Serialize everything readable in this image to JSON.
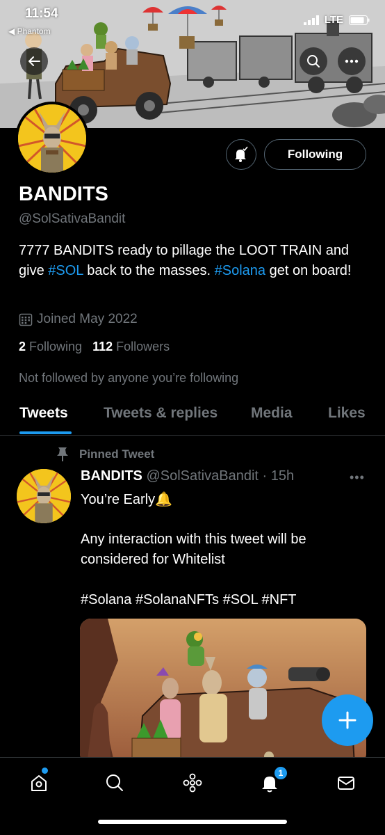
{
  "status_bar": {
    "time": "11:54",
    "back_app": "◀ Phantom",
    "network": "LTE"
  },
  "profile": {
    "name": "BANDITS",
    "handle": "@SolSativaBandit",
    "bio": [
      {
        "text": "7777 BANDITS ready to pillage the LOOT TRAIN and give ",
        "tag": false
      },
      {
        "text": "#SOL",
        "tag": true
      },
      {
        "text": " back to the masses. ",
        "tag": false
      },
      {
        "text": "#Solana",
        "tag": true
      },
      {
        "text": " get on board!",
        "tag": false
      }
    ],
    "joined": "Joined May 2022",
    "following_count": "2",
    "following_label": "Following",
    "followers_count": "112",
    "followers_label": "Followers",
    "not_followed": "Not followed by anyone you’re following",
    "follow_button": "Following"
  },
  "tabs": [
    {
      "label": "Tweets",
      "active": true
    },
    {
      "label": "Tweets & replies",
      "active": false
    },
    {
      "label": "Media",
      "active": false
    },
    {
      "label": "Likes",
      "active": false
    }
  ],
  "pinned_tweet": {
    "pinned_label": "Pinned Tweet",
    "author_name": "BANDITS",
    "author_handle": "@SolSativaBandit",
    "time": "· 15h",
    "line1": "You’re Early🔔",
    "line2": "Any interaction with this tweet will be",
    "line3": "considered for Whitelist",
    "hashtags": "#Solana #SolanaNFTs #SOL #NFT"
  },
  "bottom_nav": {
    "items": [
      "home-icon",
      "search-icon",
      "spaces-icon",
      "notifications-icon",
      "messages-icon"
    ],
    "notification_badge": "1"
  },
  "colors": {
    "accent": "#1d9bf0",
    "background": "#000000",
    "muted": "#71767b",
    "avatar_yellow": "#f3c51d"
  }
}
